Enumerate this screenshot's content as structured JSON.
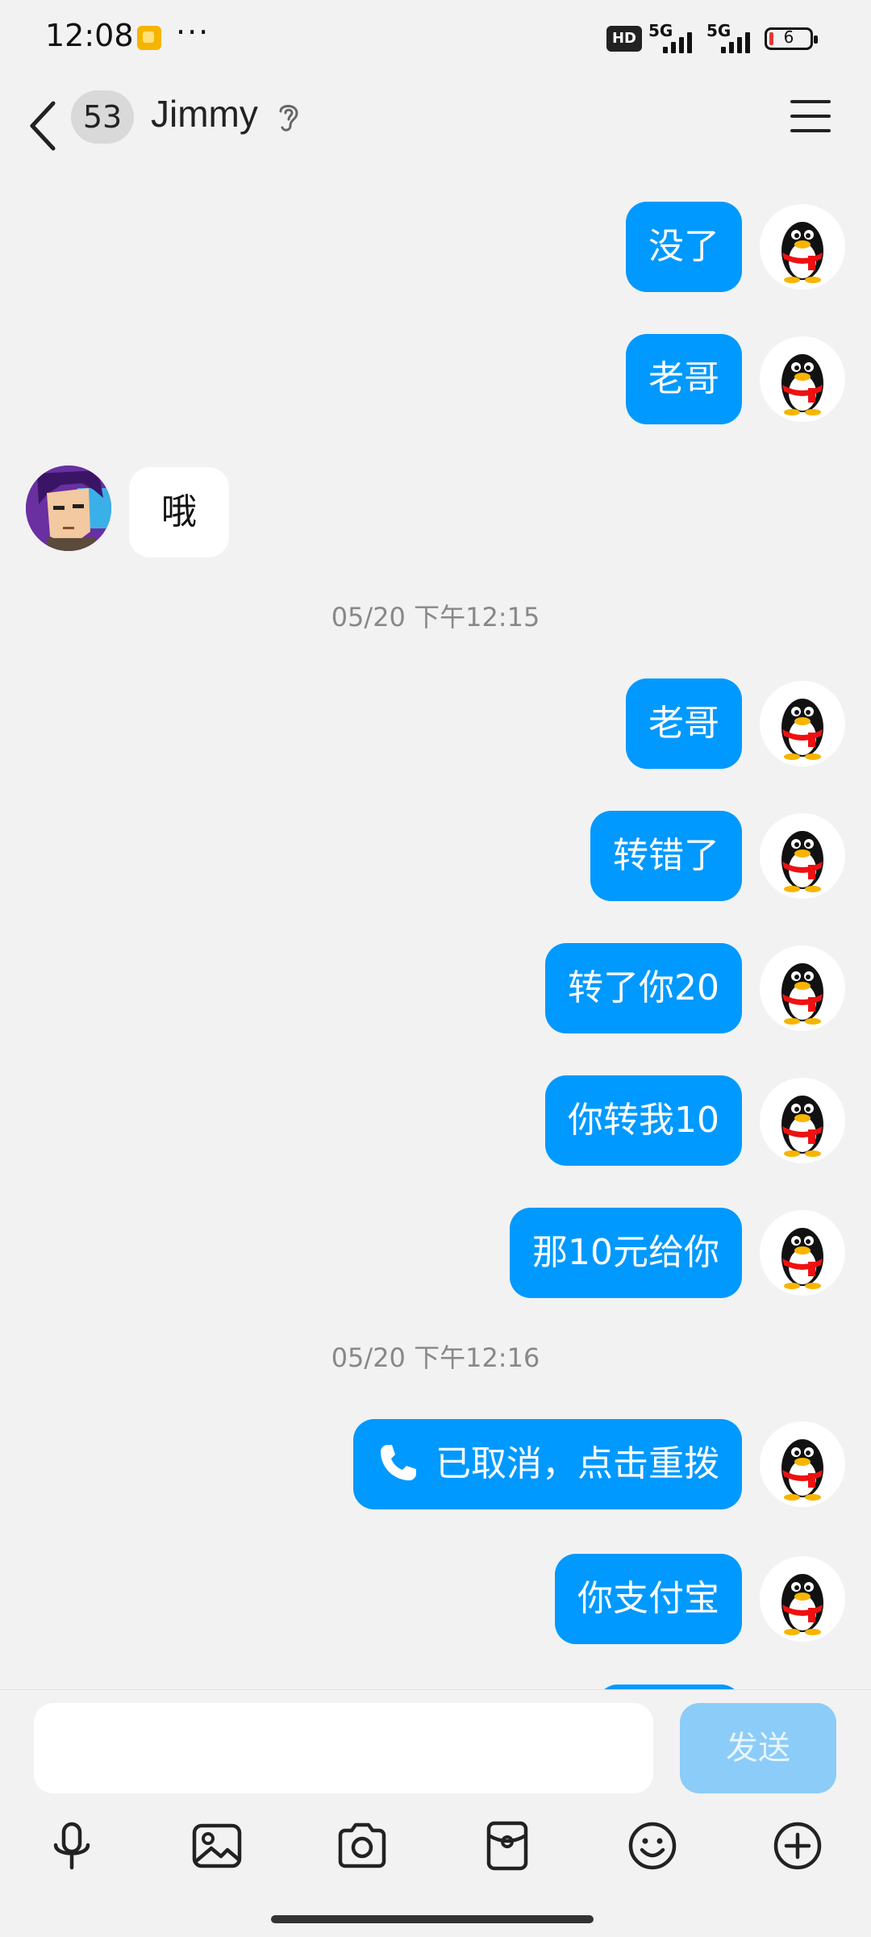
{
  "status_bar": {
    "time": "12:08",
    "dots": "···",
    "hd_label": "HD",
    "network_1": "5G",
    "network_2": "5G",
    "battery": "6"
  },
  "header": {
    "unread_count": "53",
    "contact_name": "Jimmy"
  },
  "messages": [
    {
      "side": "out",
      "text": "没了"
    },
    {
      "side": "out",
      "text": "老哥"
    },
    {
      "side": "in",
      "text": "哦"
    },
    {
      "side": "time",
      "text": "05/20 下午12:15"
    },
    {
      "side": "out",
      "text": "老哥"
    },
    {
      "side": "out",
      "text": "转错了"
    },
    {
      "side": "out",
      "text": "转了你20"
    },
    {
      "side": "out",
      "text": "你转我10"
    },
    {
      "side": "out",
      "text": "那10元给你"
    },
    {
      "side": "time",
      "text": "05/20 下午12:16"
    },
    {
      "side": "out",
      "text": "已取消，点击重拨",
      "icon": "phone-icon"
    },
    {
      "side": "out",
      "text": "你支付宝"
    }
  ],
  "composer": {
    "input_value": "",
    "send_label": "发送"
  },
  "toolbar": {
    "items": [
      "microphone-icon",
      "image-icon",
      "camera-icon",
      "red-packet-icon",
      "emoji-icon",
      "plus-icon"
    ]
  },
  "colors": {
    "bubble_out": "#0099ff",
    "bubble_in": "#ffffff",
    "background": "#f2f2f2",
    "send_disabled": "#8cccf8"
  }
}
